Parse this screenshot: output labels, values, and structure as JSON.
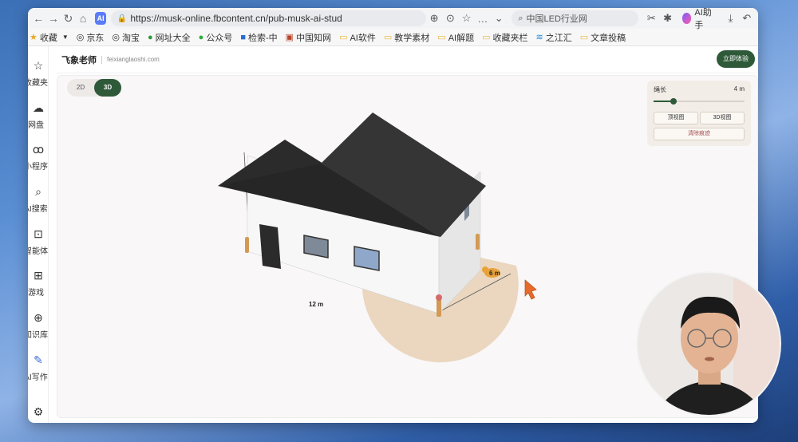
{
  "browser": {
    "url": "https://musk-online.fbcontent.cn/pub-musk-ai-stud",
    "search_placeholder": "中国LED行业网",
    "ai_badge": "AI",
    "ai_helper_label": "AI助手"
  },
  "bookmarks": [
    {
      "label": "收藏",
      "icon": "star-icon"
    },
    {
      "label": "京东",
      "icon": "globe-icon"
    },
    {
      "label": "淘宝",
      "icon": "globe-icon"
    },
    {
      "label": "网址大全",
      "icon": "nav-icon"
    },
    {
      "label": "公众号",
      "icon": "wechat-icon"
    },
    {
      "label": "检索-中",
      "icon": "search-icon"
    },
    {
      "label": "中国知网",
      "icon": "cnki-icon"
    },
    {
      "label": "AI软件",
      "icon": "folder-icon"
    },
    {
      "label": "教学素材",
      "icon": "folder-icon"
    },
    {
      "label": "AI解题",
      "icon": "folder-icon"
    },
    {
      "label": "收藏夹栏",
      "icon": "folder-icon"
    },
    {
      "label": "之江汇",
      "icon": "zjh-icon"
    },
    {
      "label": "文章投稿",
      "icon": "folder-icon"
    }
  ],
  "rail": [
    {
      "label": "收藏夹",
      "icon": "star-outline-icon"
    },
    {
      "label": "网盘",
      "icon": "cloud-icon"
    },
    {
      "label": "小程序",
      "icon": "mini-program-icon"
    },
    {
      "label": "AI搜索",
      "icon": "search-icon"
    },
    {
      "label": "智能体",
      "icon": "agent-icon"
    },
    {
      "label": "游戏",
      "icon": "gamepad-icon"
    },
    {
      "label": "知识库",
      "icon": "knowledge-icon"
    },
    {
      "label": "AI写作",
      "icon": "pen-icon"
    }
  ],
  "site": {
    "brand": "飞象老师",
    "domain": "feixianglaoshi.com",
    "cta": "立即体验"
  },
  "view_toggle": {
    "options": [
      "2D",
      "3D"
    ],
    "selected": "3D"
  },
  "control_panel": {
    "rope_label": "绳长",
    "rope_value": "4 m",
    "rope_fraction": 0.22,
    "top_view_button": "顶视图",
    "view_3d_button": "3D视图",
    "clear_button": "清除痕迹"
  },
  "scene": {
    "house_length_label": "12 m",
    "house_width_label": "6 m",
    "roof_color": "#2b2b2b",
    "wall_color": "#f7f7f7",
    "sweep_color": "#e9d3b8"
  }
}
